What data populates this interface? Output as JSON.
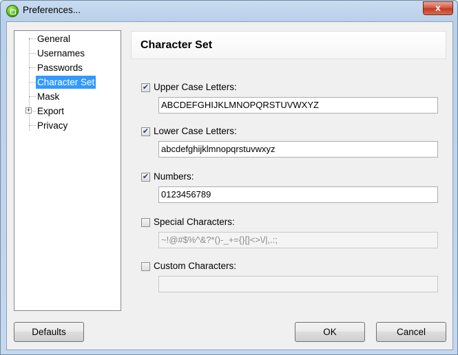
{
  "window": {
    "title": "Preferences...",
    "close_label": "x"
  },
  "tree": {
    "items": [
      {
        "label": "General",
        "selected": false,
        "expandable": false
      },
      {
        "label": "Usernames",
        "selected": false,
        "expandable": false
      },
      {
        "label": "Passwords",
        "selected": false,
        "expandable": false
      },
      {
        "label": "Character Set",
        "selected": true,
        "expandable": false
      },
      {
        "label": "Mask",
        "selected": false,
        "expandable": false
      },
      {
        "label": "Export",
        "selected": false,
        "expandable": true,
        "expander_symbol": "+"
      },
      {
        "label": "Privacy",
        "selected": false,
        "expandable": false
      }
    ]
  },
  "panel": {
    "title": "Character Set",
    "options": [
      {
        "label": "Upper Case Letters:",
        "checked": true,
        "value": "ABCDEFGHIJKLMNOPQRSTUVWXYZ",
        "enabled": true
      },
      {
        "label": "Lower Case Letters:",
        "checked": true,
        "value": "abcdefghijklmnopqrstuvwxyz",
        "enabled": true
      },
      {
        "label": "Numbers:",
        "checked": true,
        "value": "0123456789",
        "enabled": true
      },
      {
        "label": "Special Characters:",
        "checked": false,
        "value": "~!@#$%^&?*()-_+={}[]<>\\/|,.:;",
        "enabled": false
      },
      {
        "label": "Custom Characters:",
        "checked": false,
        "value": "",
        "enabled": false
      }
    ],
    "check_glyph": "✔"
  },
  "buttons": {
    "defaults": "Defaults",
    "ok": "OK",
    "cancel": "Cancel"
  },
  "colors": {
    "selection": "#3399ff",
    "title_gradient_top": "#c9dbef",
    "close_button": "#c23a22"
  }
}
